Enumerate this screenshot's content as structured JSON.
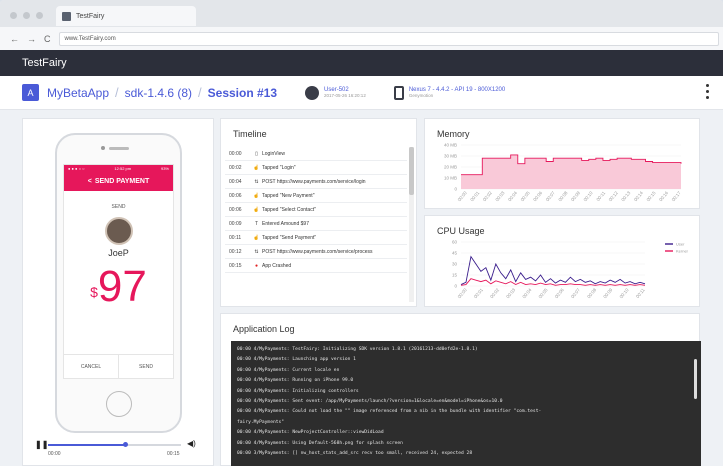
{
  "browser": {
    "tab_title": "TestFairy",
    "url": "www.TestFairy.com",
    "nav_back": "←",
    "nav_forward": "→",
    "nav_reload": "C"
  },
  "topbar": {
    "brand": "TestFairy"
  },
  "header": {
    "app_badge": "A",
    "app_name": "MyBetaApp",
    "sdk": "sdk-1.4.6 (8)",
    "session": "Session #13",
    "user": {
      "name": "User-502",
      "time": "2017-05-26 16:20:12"
    },
    "device": {
      "name": "Nexus 7 - 4.4.2 - API 19 - 800X1200",
      "sub": "Genymotion"
    }
  },
  "phone": {
    "status_left": "● ● ● ○ ○",
    "status_time": "12:52 pm",
    "status_right": "93%",
    "nav_icon": "<",
    "nav_title": "SEND PAYMENT",
    "send_label": "SEND",
    "recipient": "JoeP",
    "currency": "$",
    "amount": "97",
    "cancel": "CANCEL",
    "send": "SEND",
    "player": {
      "start": "00:00",
      "end": "00:15",
      "progress": 0.58,
      "pause_icon": "❚❚",
      "volume_icon": "◀)"
    }
  },
  "timeline": {
    "title": "Timeline",
    "rows": [
      {
        "time": "00:00",
        "icon": "▯",
        "icon_name": "phone-icon",
        "text": "LoginView"
      },
      {
        "time": "00:02",
        "icon": "☝",
        "icon_name": "tap-icon",
        "text": "Tapped \"Login\""
      },
      {
        "time": "00:04",
        "icon": "⇅",
        "icon_name": "network-icon",
        "text": "POST https://www.payments.com/service/login"
      },
      {
        "time": "00:06",
        "icon": "☝",
        "icon_name": "tap-icon",
        "text": "Tapped \"New Payment\""
      },
      {
        "time": "00:06",
        "icon": "☝",
        "icon_name": "tap-icon",
        "text": "Tapped \"Select Contact\""
      },
      {
        "time": "00:09",
        "icon": "T",
        "icon_name": "text-input-icon",
        "text": "Entered Amound $97"
      },
      {
        "time": "00:11",
        "icon": "☝",
        "icon_name": "tap-icon",
        "text": "Tapped \"Send Payment\""
      },
      {
        "time": "00:12",
        "icon": "⇅",
        "icon_name": "network-icon",
        "text": "POST https://www.payments.com/service/process"
      },
      {
        "time": "00:15",
        "icon": "●",
        "icon_name": "crash-icon",
        "text": "App Crashed"
      }
    ]
  },
  "memory": {
    "title": "Memory",
    "color": "#e6175b",
    "fill": "#f9c9d8"
  },
  "cpu": {
    "title": "CPU Usage",
    "colors": [
      "#3a1d8c",
      "#e6175b"
    ]
  },
  "chart_data": [
    {
      "type": "area",
      "title": "Memory",
      "ylim": [
        0,
        40
      ],
      "yticks": [
        "40 MB",
        "30 MB",
        "20 MB",
        "10 MB",
        "0"
      ],
      "xticks": [
        "00:00",
        "00:01",
        "00:02",
        "00:03",
        "00:04",
        "00:05",
        "00:06",
        "00:07",
        "00:08",
        "00:09",
        "00:10",
        "00:11",
        "00:12",
        "00:13",
        "00:14",
        "00:15",
        "00:16",
        "00:17"
      ],
      "series": [
        {
          "values": [
            13,
            13,
            13,
            28,
            28,
            28,
            28,
            31,
            23,
            28,
            28,
            28,
            25,
            28,
            28,
            28,
            28,
            26,
            27,
            28,
            26,
            27,
            28,
            28,
            27,
            27,
            25,
            24,
            24,
            24,
            24,
            23
          ]
        }
      ]
    },
    {
      "type": "line",
      "title": "CPU Usage",
      "ylim": [
        0,
        60
      ],
      "yticks": [
        "60",
        "45",
        "30",
        "15",
        "0"
      ],
      "xticks": [
        "00:00",
        "00:01",
        "00:02",
        "00:03",
        "00:04",
        "00:05",
        "00:06",
        "00:07",
        "00:08",
        "00:09",
        "00:10",
        "00:11"
      ],
      "legend": [
        "User",
        "Kernel"
      ],
      "series": [
        {
          "name": "User",
          "values": [
            2,
            5,
            40,
            30,
            20,
            25,
            8,
            30,
            18,
            10,
            22,
            6,
            18,
            9,
            12,
            7,
            15,
            5,
            10,
            4,
            8,
            5,
            12,
            6,
            9,
            5,
            7,
            3,
            6,
            4,
            8,
            5,
            9,
            4,
            6,
            3,
            5,
            3
          ]
        },
        {
          "name": "Kernel",
          "values": [
            1,
            2,
            10,
            8,
            6,
            8,
            3,
            7,
            5,
            3,
            6,
            2,
            5,
            2,
            3,
            2,
            4,
            2,
            3,
            1,
            2,
            2,
            3,
            2,
            2,
            1,
            2,
            1,
            2,
            1,
            2,
            1,
            2,
            1,
            2,
            1,
            2,
            1
          ]
        }
      ]
    }
  ],
  "log": {
    "title": "Application Log",
    "lines": [
      "00:00 4/MyPayments: TestFairy: Initializing SDK version 1.8.1 (20161213-dd0efd2e-1.8.1)",
      "00:00 4/MyPayments: Launching app version 1",
      "00:00 4/MyPayments: Current locale en",
      "00:00 4/MyPayments: Running on iPhone 99.0",
      "00:00 4/MyPayments: Initializing controllers",
      "00:00 4/MyPayments: Sent event: /app/MyPayments/launch/?version=1&locale=en&model=iPhone&os=10.0",
      "00:00 4/MyPayments: Could not load the \"\" image referenced from a nib in the bundle with identifier \"com.test-",
      "fairy.MyPayments\"",
      "00:00 4/MyPayments: NewProjectController::viewDidLoad",
      "00:00 4/MyPayments: Using Default-568h.png for splash screen",
      "00:00 3/MyPayments: [] nw_host_stats_add_src recv too small, received 24, expected 28"
    ]
  }
}
